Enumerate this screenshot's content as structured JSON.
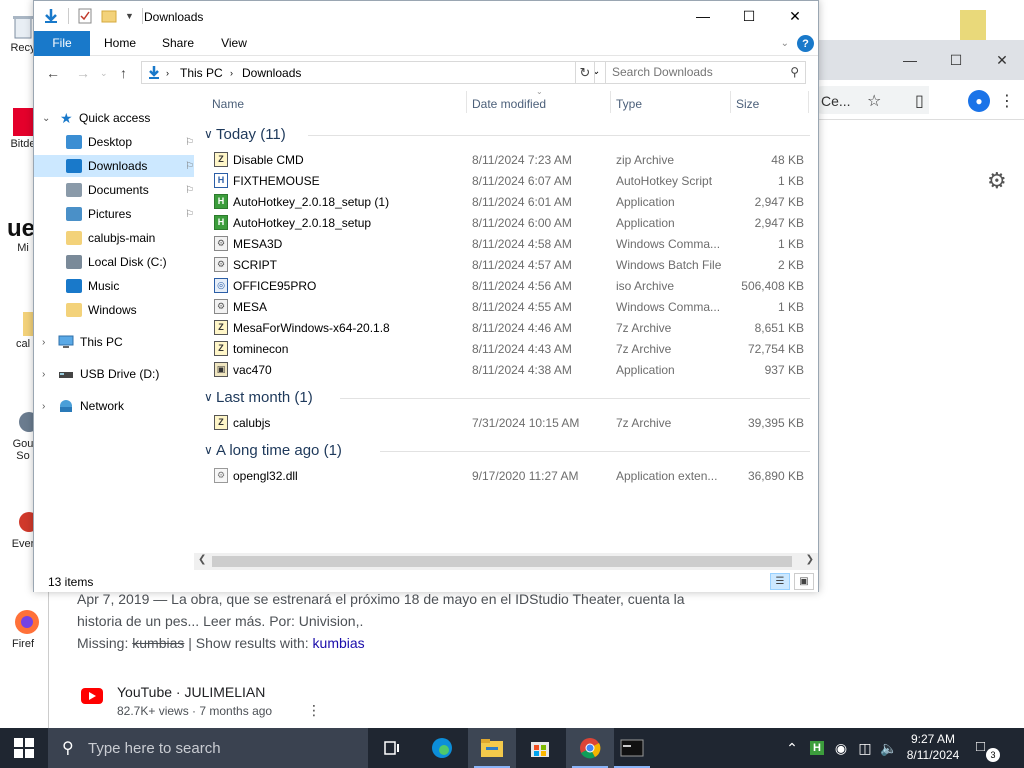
{
  "desktop": {
    "icons": [
      {
        "label": "Recy",
        "icon": "recycle-bin-icon"
      },
      {
        "label": "Bitde",
        "icon": "bitdefender-icon"
      },
      {
        "label": "Mi",
        "icon": "app-icon"
      },
      {
        "label": "cal",
        "icon": "folder-icon"
      },
      {
        "label": "Gou",
        "icon": "app-icon"
      },
      {
        "label": "So",
        "icon": "app-icon"
      },
      {
        "label": "Ever",
        "icon": "app-icon"
      },
      {
        "label": "Firef",
        "icon": "firefox-icon"
      }
    ]
  },
  "chrome": {
    "omnibox_text": "Ce...",
    "content": {
      "snippet_line1": "Apr 7, 2019 — La obra, que se estrenará el próximo 18 de mayo en el IDStudio Theater, cuenta la",
      "snippet_line2": "historia de un pes... Leer más. Por: Univision,.",
      "missing_label": "Missing:",
      "missing_word": "kumbias",
      "show_results_label": "| Show results with:",
      "show_results_link": "kumbias",
      "yt_title": "YouTube · JULIMELIAN",
      "yt_meta": "82.7K+ views · 7 months ago"
    }
  },
  "explorer": {
    "title": "Downloads",
    "ribbon_tabs": [
      "File",
      "Home",
      "Share",
      "View"
    ],
    "address": {
      "crumb1": "This PC",
      "crumb2": "Downloads"
    },
    "search_placeholder": "Search Downloads",
    "nav": {
      "quick_access": "Quick access",
      "items": [
        {
          "label": "Desktop",
          "icon": "desktop-icon",
          "pinned": true
        },
        {
          "label": "Downloads",
          "icon": "downloads-icon",
          "pinned": true
        },
        {
          "label": "Documents",
          "icon": "documents-icon",
          "pinned": true
        },
        {
          "label": "Pictures",
          "icon": "pictures-icon",
          "pinned": true
        },
        {
          "label": "calubjs-main",
          "icon": "folder-icon",
          "pinned": false
        },
        {
          "label": "Local Disk (C:)",
          "icon": "drive-icon",
          "pinned": false
        },
        {
          "label": "Music",
          "icon": "music-icon",
          "pinned": false
        },
        {
          "label": "Windows",
          "icon": "folder-icon",
          "pinned": false
        }
      ],
      "this_pc": "This PC",
      "usb": "USB Drive (D:)",
      "network": "Network"
    },
    "columns": {
      "name": "Name",
      "date": "Date modified",
      "type": "Type",
      "size": "Size"
    },
    "groups": [
      {
        "label": "Today (11)",
        "files": [
          {
            "name": "Disable CMD",
            "date": "8/11/2024 7:23 AM",
            "type": "zip Archive",
            "size": "48 KB",
            "icon": "archive-icon"
          },
          {
            "name": "FIXTHEMOUSE",
            "date": "8/11/2024 6:07 AM",
            "type": "AutoHotkey Script",
            "size": "1 KB",
            "icon": "ahk-script-icon"
          },
          {
            "name": "AutoHotkey_2.0.18_setup (1)",
            "date": "8/11/2024 6:01 AM",
            "type": "Application",
            "size": "2,947 KB",
            "icon": "autohotkey-icon"
          },
          {
            "name": "AutoHotkey_2.0.18_setup",
            "date": "8/11/2024 6:00 AM",
            "type": "Application",
            "size": "2,947 KB",
            "icon": "autohotkey-icon"
          },
          {
            "name": "MESA3D",
            "date": "8/11/2024 4:58 AM",
            "type": "Windows Comma...",
            "size": "1 KB",
            "icon": "batch-icon"
          },
          {
            "name": "SCRIPT",
            "date": "8/11/2024 4:57 AM",
            "type": "Windows Batch File",
            "size": "2 KB",
            "icon": "batch-icon"
          },
          {
            "name": "OFFICE95PRO",
            "date": "8/11/2024 4:56 AM",
            "type": "iso Archive",
            "size": "506,408 KB",
            "icon": "iso-icon"
          },
          {
            "name": "MESA",
            "date": "8/11/2024 4:55 AM",
            "type": "Windows Comma...",
            "size": "1 KB",
            "icon": "batch-icon"
          },
          {
            "name": "MesaForWindows-x64-20.1.8",
            "date": "8/11/2024 4:46 AM",
            "type": "7z Archive",
            "size": "8,651 KB",
            "icon": "archive-icon"
          },
          {
            "name": "tominecon",
            "date": "8/11/2024 4:43 AM",
            "type": "7z Archive",
            "size": "72,754 KB",
            "icon": "archive-icon"
          },
          {
            "name": "vac470",
            "date": "8/11/2024 4:38 AM",
            "type": "Application",
            "size": "937 KB",
            "icon": "installer-icon"
          }
        ]
      },
      {
        "label": "Last month (1)",
        "files": [
          {
            "name": "calubjs",
            "date": "7/31/2024 10:15 AM",
            "type": "7z Archive",
            "size": "39,395 KB",
            "icon": "archive-icon"
          }
        ]
      },
      {
        "label": "A long time ago (1)",
        "files": [
          {
            "name": "opengl32.dll",
            "date": "9/17/2020 11:27 AM",
            "type": "Application exten...",
            "size": "36,890 KB",
            "icon": "dll-icon"
          }
        ]
      }
    ],
    "status": "13 items"
  },
  "taskbar": {
    "search_placeholder": "Type here to search",
    "time": "9:27 AM",
    "date": "8/11/2024",
    "notification_count": "3"
  }
}
